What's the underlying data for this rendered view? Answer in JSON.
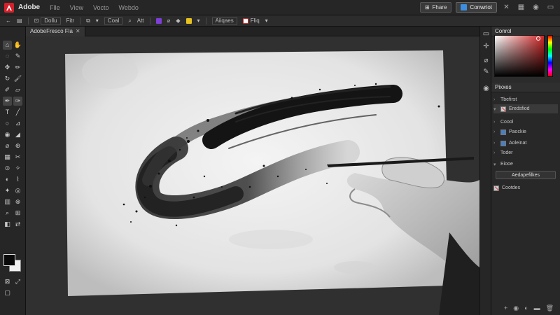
{
  "menubar": {
    "app_name": "Adobe",
    "menus": [
      "Flle",
      "View",
      "Vocto",
      "Webdo"
    ],
    "share_label": "Fhare",
    "download_label": "Conwriot"
  },
  "options_bar": {
    "items": [
      "Dollu",
      "Fitr",
      "Coal",
      "Att",
      "Aiiqaes",
      "Fliq"
    ]
  },
  "doc_tab": {
    "title": "AdobeFresco Fla"
  },
  "panels": {
    "color_title": "Conrol",
    "layers_title": "Pixxes",
    "layers": [
      {
        "label": "Tbefirst",
        "thumb": "none"
      },
      {
        "label": "Eredsfiod",
        "thumb": "red"
      },
      {
        "label": "Coool",
        "thumb": "none"
      },
      {
        "label": "Paockie",
        "thumb": "blue"
      },
      {
        "label": "Aoleinat",
        "thumb": "blue"
      },
      {
        "label": "Toder",
        "thumb": "none"
      },
      {
        "label": "Eiooe",
        "thumb": "none"
      },
      {
        "label": "Cootdes",
        "thumb": "red"
      }
    ],
    "add_layer_label": "Aedapefilkes"
  }
}
